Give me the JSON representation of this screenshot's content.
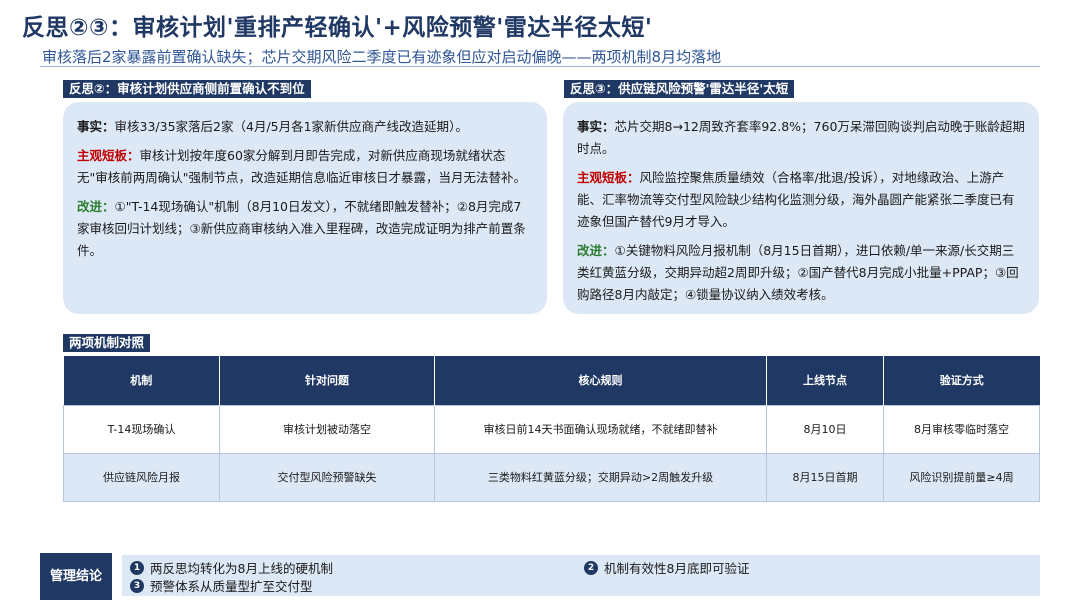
{
  "header": {
    "title": "反思②③：审核计划'重排产轻确认'+风险预警'雷达半径太短'",
    "subtitle": "审核落后2家暴露前置确认缺失；芯片交期风险二季度已有迹象但应对启动偏晚——两项机制8月均落地"
  },
  "left": {
    "heading": "反思②：审核计划供应商侧前置确认不到位",
    "fact_key": "事实：",
    "fact": "审核33/35家落后2家（4月/5月各1家新供应商产线改造延期）。",
    "weak_key": "主观短板：",
    "weak": "审核计划按年度60家分解到月即告完成，对新供应商现场就绪状态无\"审核前两周确认\"强制节点，改造延期信息临近审核日才暴露，当月无法替补。",
    "fix_key": "改进：",
    "fix": "①\"T-14现场确认\"机制（8月10日发文），不就绪即触发替补；②8月完成7家审核回归计划线；③新供应商审核纳入准入里程碑，改造完成证明为排产前置条件。"
  },
  "right": {
    "heading": "反思③：供应链风险预警'雷达半径'太短",
    "fact_key": "事实：",
    "fact": "芯片交期8→12周致齐套率92.8%；760万呆滞回购谈判启动晚于账龄超期时点。",
    "weak_key": "主观短板：",
    "weak": "风险监控聚焦质量绩效（合格率/批退/投诉），对地缘政治、上游产能、汇率物流等交付型风险缺少结构化监测分级，海外晶圆产能紧张二季度已有迹象但国产替代9月才导入。",
    "fix_key": "改进：",
    "fix": "①关键物料风险月报机制（8月15日首期），进口依赖/单一来源/长交期三类红黄蓝分级，交期异动超2周即升级；②国产替代8月完成小批量+PPAP；③回购路径8月内敲定；④锁量协议纳入绩效考核。"
  },
  "table": {
    "heading": "两项机制对照",
    "columns": [
      "机制",
      "针对问题",
      "核心规则",
      "上线节点",
      "验证方式"
    ],
    "rows": [
      [
        "T-14现场确认",
        "审核计划被动落空",
        "审核日前14天书面确认现场就绪，不就绪即替补",
        "8月10日",
        "8月审核零临时落空"
      ],
      [
        "供应链风险月报",
        "交付型风险预警缺失",
        "三类物料红黄蓝分级；交期异动>2周触发升级",
        "8月15日首期",
        "风险识别提前量≥4周"
      ]
    ]
  },
  "conclusion": {
    "label": "管理结论",
    "items": [
      {
        "num": "1",
        "text": "两反思均转化为8月上线的硬机制"
      },
      {
        "num": "2",
        "text": "机制有效性8月底即可验证"
      },
      {
        "num": "3",
        "text": "预警体系从质量型扩至交付型"
      }
    ]
  },
  "colors": {
    "navy": "#1f3864",
    "card_bg": "#dde8f7",
    "weak_red": "#c00000",
    "fix_green": "#2e7d32"
  }
}
